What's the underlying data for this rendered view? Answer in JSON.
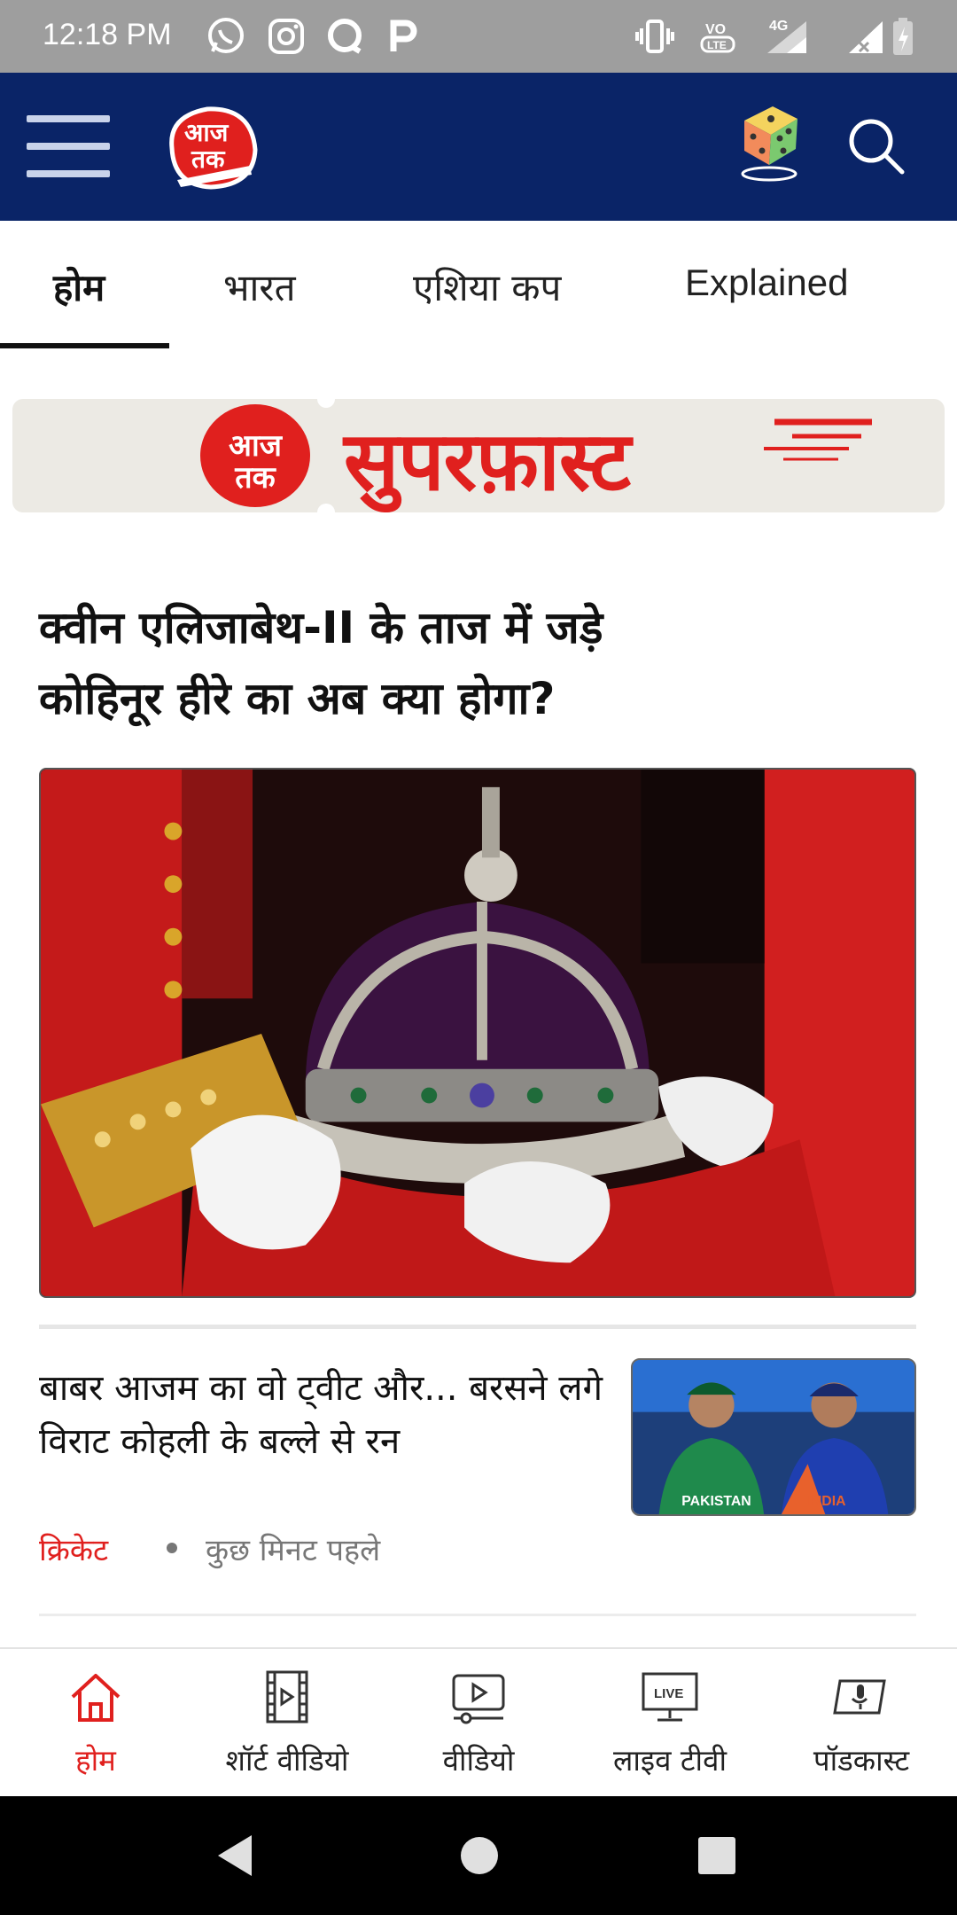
{
  "status_bar": {
    "time": "12:18 PM",
    "network": "4G",
    "volte": "VO LTE",
    "icons": [
      "whatsapp-icon",
      "instagram-icon",
      "chat-icon",
      "p-icon",
      "vibrate-icon",
      "volte-icon",
      "signal-icon",
      "signal-x-icon",
      "battery-icon"
    ]
  },
  "header": {
    "logo_line1": "आज",
    "logo_line2": "तक",
    "icons": [
      "menu-icon",
      "dice-icon",
      "search-icon"
    ],
    "brand_color": "#0a2467",
    "accent_color": "#e0201e"
  },
  "tabs": [
    {
      "label": "होम",
      "active": true
    },
    {
      "label": "भारत",
      "active": false
    },
    {
      "label": "एशिया कप",
      "active": false
    },
    {
      "label": "Explained",
      "active": false
    }
  ],
  "banner": {
    "logo_line1": "आज",
    "logo_line2": "तक",
    "title": "सुपरफ़ास्ट"
  },
  "lead_story": {
    "headline": "क्वीन एलिजाबेथ-II के ताज में जड़े कोहिनूर हीरे का अब क्या होगा?"
  },
  "story": {
    "title": "बाबर आजम का वो ट्वीट और... बरसने लगे विराट कोहली के बल्ले से रन",
    "category": "क्रिकेट",
    "time": "कुछ मिनट पहले",
    "thumb_jersey_left": "PAKISTAN",
    "thumb_jersey_right": "INDIA"
  },
  "bottom_nav": [
    {
      "label": "होम",
      "icon": "home-icon",
      "active": true
    },
    {
      "label": "शॉर्ट वीडियो",
      "icon": "short-video-icon",
      "active": false
    },
    {
      "label": "वीडियो",
      "icon": "video-icon",
      "active": false
    },
    {
      "label": "लाइव टीवी",
      "icon": "live-tv-icon",
      "active": false,
      "badge": "LIVE"
    },
    {
      "label": "पॉडकास्ट",
      "icon": "podcast-icon",
      "active": false
    }
  ]
}
